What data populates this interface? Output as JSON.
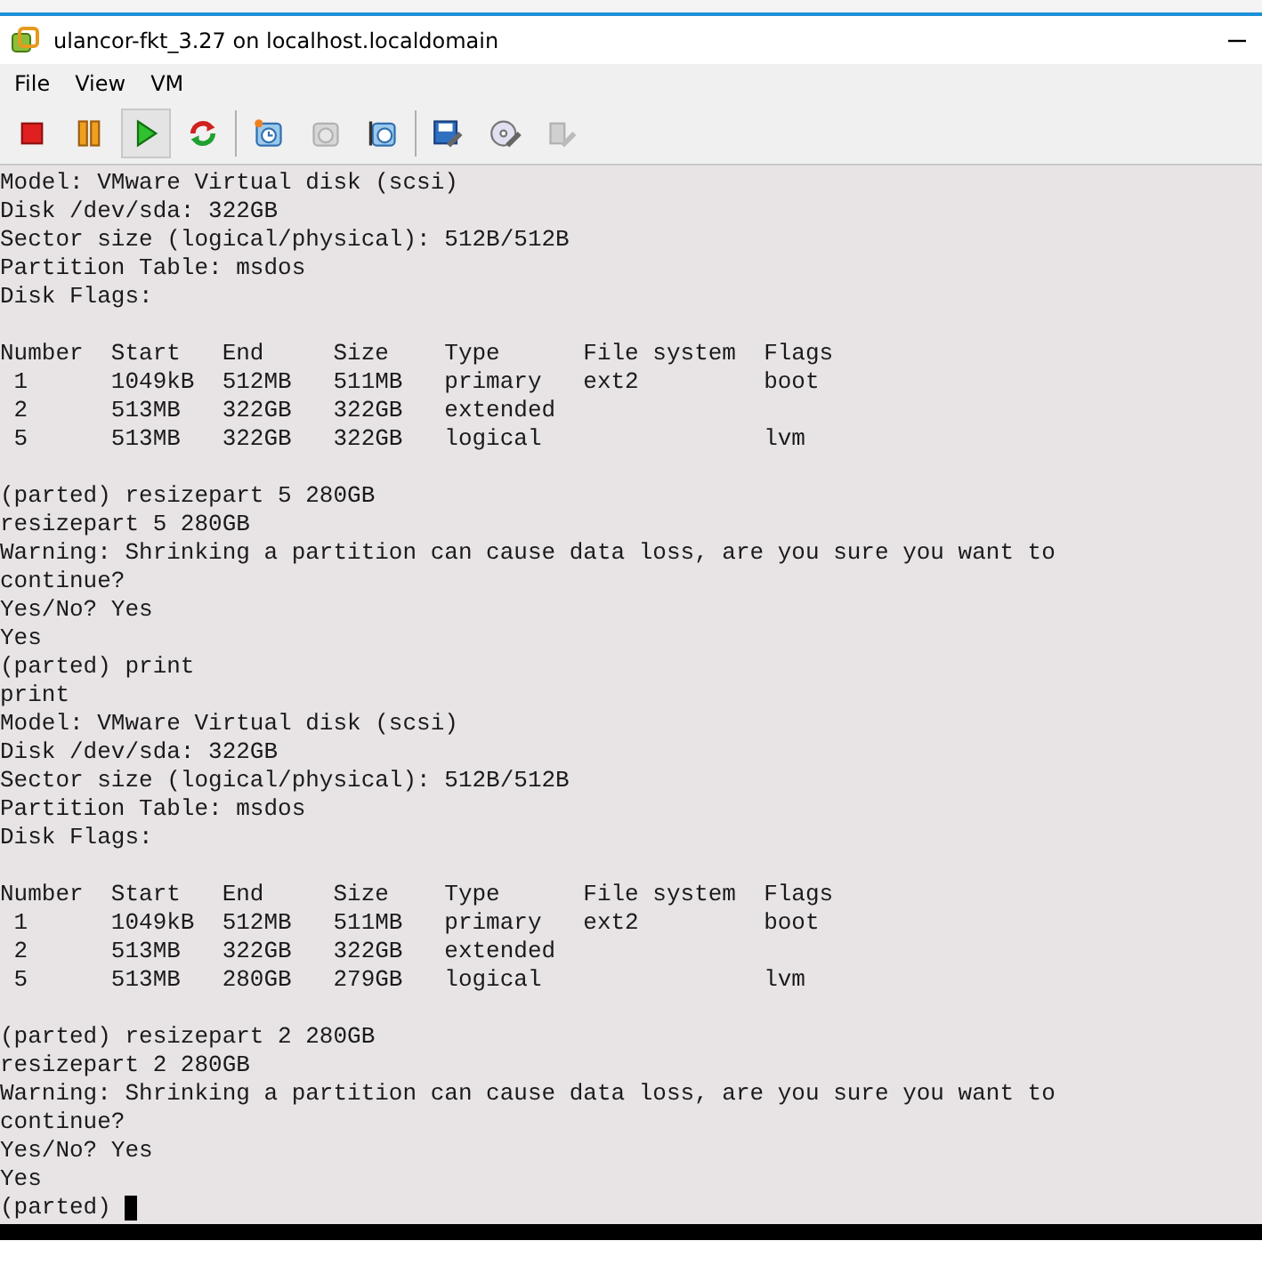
{
  "window": {
    "title": "ulancor-fkt_3.27 on localhost.localdomain"
  },
  "menu": [
    "File",
    "View",
    "VM"
  ],
  "toolbar": [
    {
      "kind": "stop",
      "selected": false,
      "disabled": false
    },
    {
      "kind": "pause",
      "selected": false,
      "disabled": false
    },
    {
      "kind": "play",
      "selected": true,
      "disabled": false
    },
    {
      "kind": "reset",
      "selected": false,
      "disabled": false
    },
    {
      "kind": "snapshot",
      "selected": false,
      "disabled": false
    },
    {
      "kind": "revert",
      "selected": false,
      "disabled": true
    },
    {
      "kind": "manager",
      "selected": false,
      "disabled": false
    },
    {
      "kind": "settings",
      "selected": false,
      "disabled": false
    },
    {
      "kind": "cd",
      "selected": false,
      "disabled": false
    },
    {
      "kind": "usb",
      "selected": false,
      "disabled": true
    }
  ],
  "console": {
    "cursor": true,
    "blocks": [
      [
        "Model: VMware Virtual disk (scsi)",
        "Disk /dev/sda: 322GB",
        "Sector size (logical/physical): 512B/512B",
        "Partition Table: msdos",
        "Disk Flags:"
      ],
      [
        "Number  Start   End     Size    Type      File system  Flags",
        " 1      1049kB  512MB   511MB   primary   ext2         boot",
        " 2      513MB   322GB   322GB   extended",
        " 5      513MB   322GB   322GB   logical                lvm"
      ],
      [
        "(parted) resizepart 5 280GB",
        "resizepart 5 280GB",
        "Warning: Shrinking a partition can cause data loss, are you sure you want to",
        "continue?",
        "Yes/No? Yes",
        "Yes",
        "(parted) print",
        "print",
        "Model: VMware Virtual disk (scsi)",
        "Disk /dev/sda: 322GB",
        "Sector size (logical/physical): 512B/512B",
        "Partition Table: msdos",
        "Disk Flags:"
      ],
      [
        "Number  Start   End     Size    Type      File system  Flags",
        " 1      1049kB  512MB   511MB   primary   ext2         boot",
        " 2      513MB   322GB   322GB   extended",
        " 5      513MB   280GB   279GB   logical                lvm"
      ],
      [
        "(parted) resizepart 2 280GB",
        "resizepart 2 280GB",
        "Warning: Shrinking a partition can cause data loss, are you sure you want to",
        "continue?",
        "Yes/No? Yes",
        "Yes",
        "(parted)"
      ]
    ]
  }
}
